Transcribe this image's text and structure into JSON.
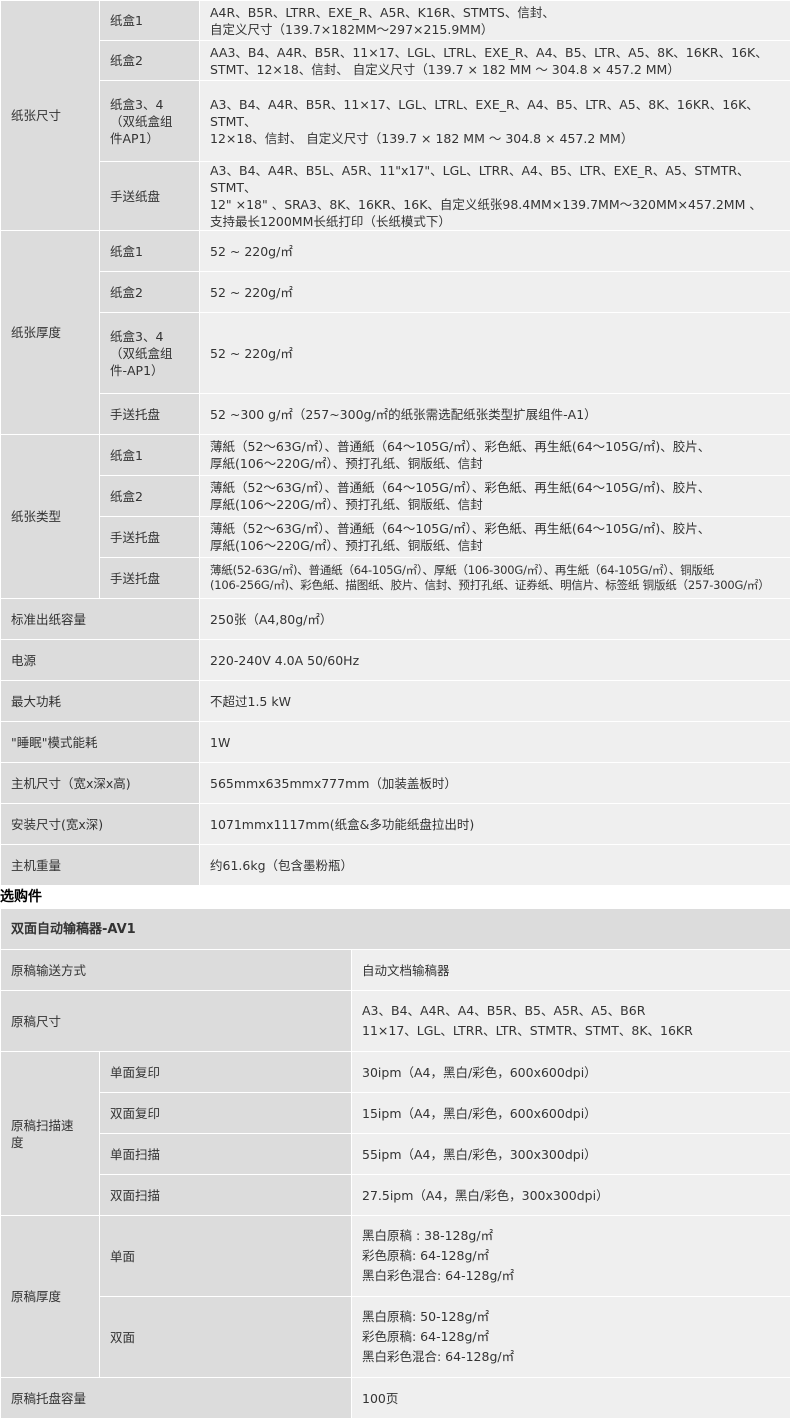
{
  "spec": {
    "paper_size": {
      "label": "纸张尺寸",
      "rows": [
        {
          "sub": "纸盒1",
          "val": "A4R、B5R、LTRR、EXE_R、A5R、K16R、STMTS、信封、\n自定义尺寸（139.7×182MM～297×215.9MM）"
        },
        {
          "sub": "纸盒2",
          "val": "AA3、B4、A4R、B5R、11×17、LGL、LTRL、EXE_R、A4、B5、LTR、A5、8K、16KR、16K、\nSTMT、12×18、信封、 自定义尺寸（139.7 × 182 MM ～ 304.8 × 457.2 MM）"
        },
        {
          "sub": "纸盒3、4\n（双纸盒组\n件AP1）",
          "val": "A3、B4、A4R、B5R、11×17、LGL、LTRL、EXE_R、A4、B5、LTR、A5、8K、16KR、16K、STMT、\n12×18、信封、 自定义尺寸（139.7 × 182 MM ～ 304.8 × 457.2 MM）"
        },
        {
          "sub": "手送纸盘",
          "val": "A3、B4、A4R、B5L、A5R、11\"x17\"、LGL、LTRR、A4、B5、LTR、EXE_R、A5、STMTR、STMT、\n12\" ×18\" 、SRA3、8K、16KR、16K、自定义纸张98.4MM×139.7MM～320MM×457.2MM 、\n支持最长1200MM长纸打印（长纸模式下）"
        }
      ]
    },
    "paper_weight": {
      "label": "纸张厚度",
      "rows": [
        {
          "sub": "纸盒1",
          "val": "52 ~ 220g/㎡"
        },
        {
          "sub": "纸盒2",
          "val": "52 ~ 220g/㎡"
        },
        {
          "sub": "纸盒3、4\n（双纸盒组\n件-AP1）",
          "val": "52 ~ 220g/㎡"
        },
        {
          "sub": "手送托盘",
          "val": "52 ~300 g/㎡（257~300g/㎡的纸张需选配纸张类型扩展组件-A1）"
        }
      ]
    },
    "paper_type": {
      "label": "纸张类型",
      "rows": [
        {
          "sub": "纸盒1",
          "val": "薄紙（52～63G/㎡）、普通紙（64～105G/㎡）、彩色紙、再生紙(64～105G/㎡)、胶片、\n厚紙(106～220G/㎡）、预打孔纸、铜版纸、信封"
        },
        {
          "sub": "纸盒2",
          "val": "薄紙（52～63G/㎡）、普通紙（64～105G/㎡）、彩色紙、再生紙(64～105G/㎡)、胶片、\n厚紙(106～220G/㎡）、预打孔纸、铜版纸、信封"
        },
        {
          "sub": "手送托盘",
          "val": "薄紙（52～63G/㎡）、普通紙（64～105G/㎡）、彩色紙、再生紙(64～105G/㎡)、胶片、\n厚紙(106～220G/㎡）、预打孔纸、铜版纸、信封"
        },
        {
          "sub": "手送托盘",
          "val": "薄紙(52-63G/㎡)、普通紙（64-105G/㎡）、厚紙（106-300G/㎡）、再生紙（64-105G/㎡）、铜版纸\n(106-256G/㎡)、彩色紙、描图纸、胶片、信封、预打孔纸、证券纸、明信片、标签纸 铜版纸（257-300G/㎡）"
        }
      ]
    },
    "simple_rows": [
      {
        "label": "标准出纸容量",
        "val": "250张（A4,80g/㎡）"
      },
      {
        "label": "电源",
        "val": "220-240V 4.0A 50/60Hz"
      },
      {
        "label": "最大功耗",
        "val": "不超过1.5 kW"
      },
      {
        "label": "\"睡眠\"模式能耗",
        "val": "1W"
      },
      {
        "label": "主机尺寸（宽x深x高)",
        "val": "565mmx635mmx777mm（加装盖板时）"
      },
      {
        "label": "安装尺寸(宽x深)",
        "val": "1071mmx1117mm(纸盒&多功能纸盘拉出时)"
      },
      {
        "label": "主机重量",
        "val": "约61.6kg（包含墨粉瓶）"
      }
    ]
  },
  "options": {
    "section_title": "选购件",
    "adf_title": "双面自动输稿器-AV1",
    "feed": {
      "label": "原稿输送方式",
      "val": "自动文档输稿器"
    },
    "size": {
      "label": "原稿尺寸",
      "val": "A3、B4、A4R、A4、B5R、B5、A5R、A5、B6R\n11×17、LGL、LTRR、LTR、STMTR、STMT、8K、16KR"
    },
    "speed": {
      "label": "原稿扫描速\n度",
      "rows": [
        {
          "sub": "单面复印",
          "val": "30ipm（A4，黑白/彩色，600x600dpi）"
        },
        {
          "sub": "双面复印",
          "val": "15ipm（A4，黑白/彩色，600x600dpi）"
        },
        {
          "sub": "单面扫描",
          "val": "55ipm（A4，黑白/彩色，300x300dpi）"
        },
        {
          "sub": "双面扫描",
          "val": "27.5ipm（A4，黑白/彩色，300x300dpi）"
        }
      ]
    },
    "weight": {
      "label": "原稿厚度",
      "rows": [
        {
          "sub": "单面",
          "val": "黑白原稿 : 38-128g/㎡\n彩色原稿: 64-128g/㎡\n黑白彩色混合: 64-128g/㎡"
        },
        {
          "sub": "双面",
          "val": "黑白原稿: 50-128g/㎡\n彩色原稿: 64-128g/㎡\n黑白彩色混合: 64-128g/㎡"
        }
      ]
    },
    "tray": {
      "label": "原稿托盘容量",
      "val": "100页"
    }
  }
}
